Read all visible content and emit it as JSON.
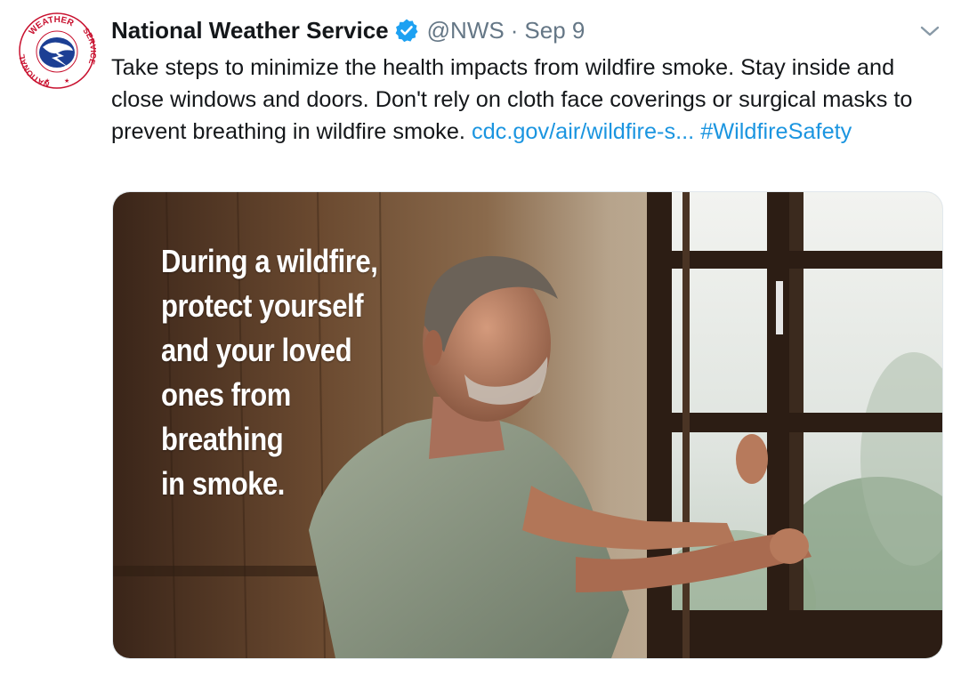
{
  "tweet": {
    "author_name": "National Weather Service",
    "author_handle": "@NWS",
    "separator": "·",
    "date": "Sep 9",
    "verified": true,
    "avatar_icon": "nws-logo-icon",
    "avatar_ring_top": "WEATHER",
    "avatar_ring_left": "NATIONAL",
    "avatar_ring_right": "SERVICE",
    "text_part1": "Take steps to minimize the health impacts from wildfire smoke. Stay inside and close windows and doors. Don't rely on cloth face coverings or surgical masks to prevent breathing in wildfire smoke. ",
    "link_text": "cdc.gov/air/wildfire-s...",
    "hashtag": "#WildfireSafety",
    "more_icon": "chevron-down-icon"
  },
  "media": {
    "overlay_lines": [
      "During a wildfire,",
      "protect yourself",
      "and your loved",
      "ones from",
      "breathing",
      "in smoke."
    ]
  },
  "colors": {
    "link": "#1b95e0",
    "secondary_text": "#657786",
    "verified_badge": "#1da1f2",
    "nws_ring": "#c8102e",
    "nws_blue": "#1c3f94"
  }
}
